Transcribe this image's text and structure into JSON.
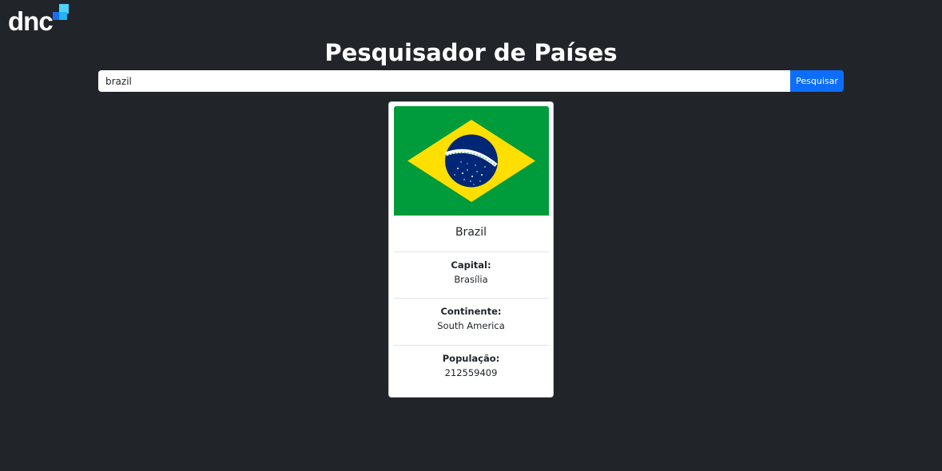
{
  "logo": {
    "text": "dnc",
    "colors": {
      "dark": "#1a6df0",
      "light": "#22b4f5",
      "top": "#4fd2ff"
    }
  },
  "header": {
    "title": "Pesquisador de Países"
  },
  "search": {
    "value": "brazil",
    "button_label": "Pesquisar"
  },
  "country": {
    "name": "Brazil",
    "flag_icon": "flag-brazil",
    "capital_label": "Capital:",
    "capital": "Brasília",
    "continent_label": "Continente:",
    "continent": "South America",
    "population_label": "População:",
    "population": "212559409"
  },
  "colors": {
    "background": "#212529",
    "accent": "#0d6efd",
    "flag_green": "#009b3a",
    "flag_yellow": "#fedf00",
    "flag_blue": "#002776"
  }
}
